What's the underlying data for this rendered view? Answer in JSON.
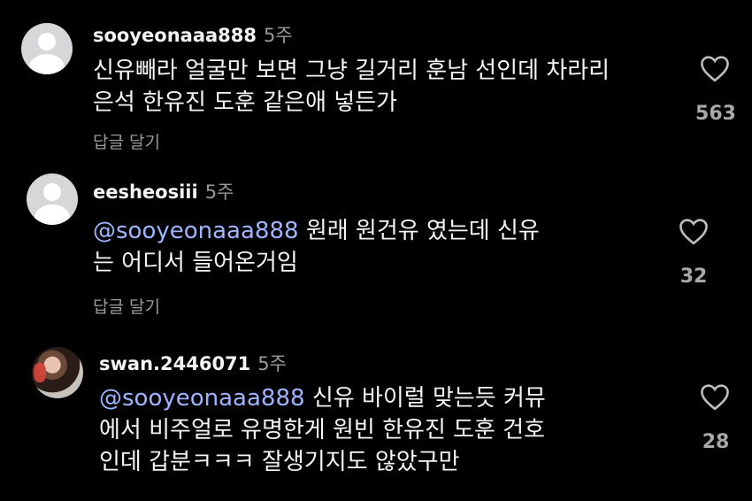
{
  "comments": [
    {
      "username": "sooyeonaaa888",
      "time": "5주",
      "mention": "",
      "text": "신유빼라 얼굴만 보면 그냥 길거리 훈남 선인데 차라리",
      "text2": "은석 한유진 도훈 같은애 넣든가",
      "likes": "563",
      "reply_label": "답글 달기"
    },
    {
      "username": "eesheosiii",
      "time": "5주",
      "mention": "@sooyeonaaa888",
      "text": " 원래 원건유 였는데 신유",
      "text2": "는 어디서 들어온거임",
      "likes": "32",
      "reply_label": "답글 달기"
    },
    {
      "username": "swan.2446071",
      "time": "5주",
      "mention": "@sooyeonaaa888",
      "text": " 신유 바이럴 맞는듯 커뮤",
      "text2": "에서 비주얼로 유명한게 원빈 한유진 도훈 건호",
      "text3": "인데 갑분ㅋㅋㅋ 잘생기지도 않았구만",
      "likes": "28"
    }
  ],
  "icons": {
    "like": "heart-outline-icon",
    "avatar_default": "default-avatar-icon"
  },
  "colors": {
    "background": "#000000",
    "mention": "#9fb4ff",
    "muted": "#9a9a9a"
  }
}
